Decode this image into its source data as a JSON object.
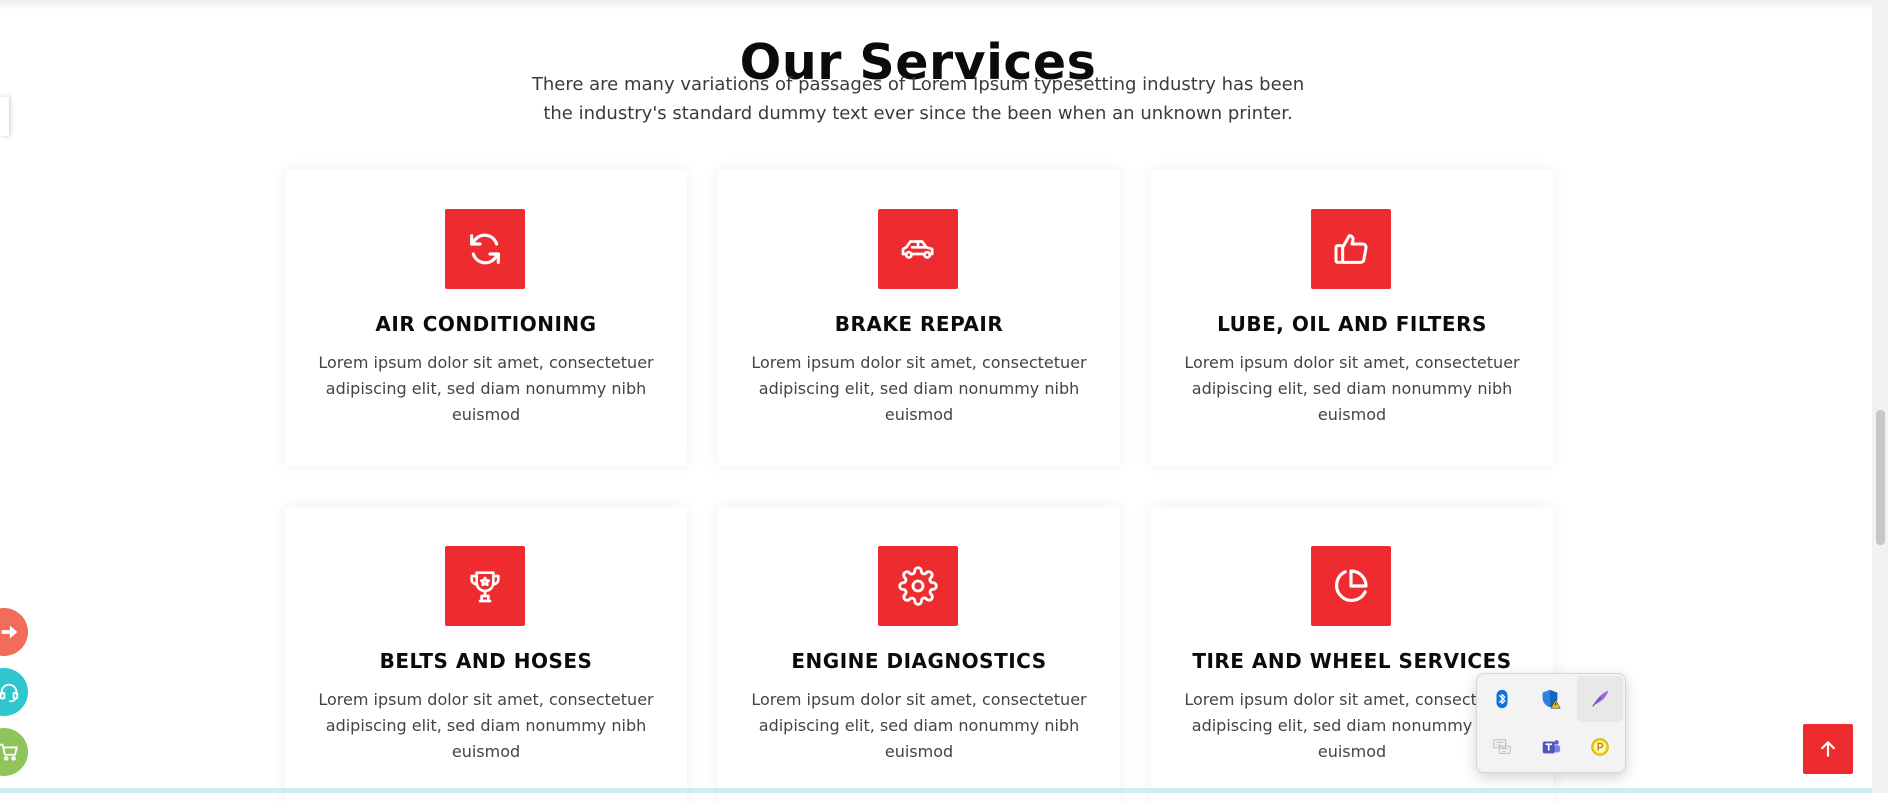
{
  "section": {
    "title": "Our Services",
    "subtitle_line1": "There are many variations of passages of Lorem Ipsum typesetting industry has been",
    "subtitle_line2": "the industry's standard dummy text ever since the been when an unknown printer."
  },
  "services": [
    {
      "title": "AIR CONDITIONING",
      "desc": "Lorem ipsum dolor sit amet, consectetuer adipiscing elit, sed diam nonummy nibh euismod",
      "icon": "refresh-icon"
    },
    {
      "title": "BRAKE REPAIR",
      "desc": "Lorem ipsum dolor sit amet, consectetuer adipiscing elit, sed diam nonummy nibh euismod",
      "icon": "car-icon"
    },
    {
      "title": "LUBE, OIL AND FILTERS",
      "desc": "Lorem ipsum dolor sit amet, consectetuer adipiscing elit, sed diam nonummy nibh euismod",
      "icon": "thumbs-up-icon"
    },
    {
      "title": "BELTS AND HOSES",
      "desc": "Lorem ipsum dolor sit amet, consectetuer adipiscing elit, sed diam nonummy nibh euismod",
      "icon": "trophy-icon"
    },
    {
      "title": "ENGINE DIAGNOSTICS",
      "desc": "Lorem ipsum dolor sit amet, consectetuer adipiscing elit, sed diam nonummy nibh euismod",
      "icon": "gear-icon"
    },
    {
      "title": "TIRE AND WHEEL SERVICES",
      "desc": "Lorem ipsum dolor sit amet, consectetuer adipiscing elit, sed diam nonummy nibh euismod",
      "icon": "pie-chart-icon"
    }
  ],
  "floating_buttons": [
    {
      "icon": "arrow-right-icon",
      "color": "#f26c5c"
    },
    {
      "icon": "headset-icon",
      "color": "#2fc6cf"
    },
    {
      "icon": "cart-icon",
      "color": "#8fc45a"
    }
  ],
  "tray_icons": [
    "bluetooth-icon",
    "security-shield-warning-icon",
    "quill-icon",
    "chat-icon",
    "teams-icon",
    "p-coin-icon"
  ],
  "colors": {
    "accent": "#ee2b2f",
    "heading": "#0b0b0b",
    "text": "#444444"
  }
}
